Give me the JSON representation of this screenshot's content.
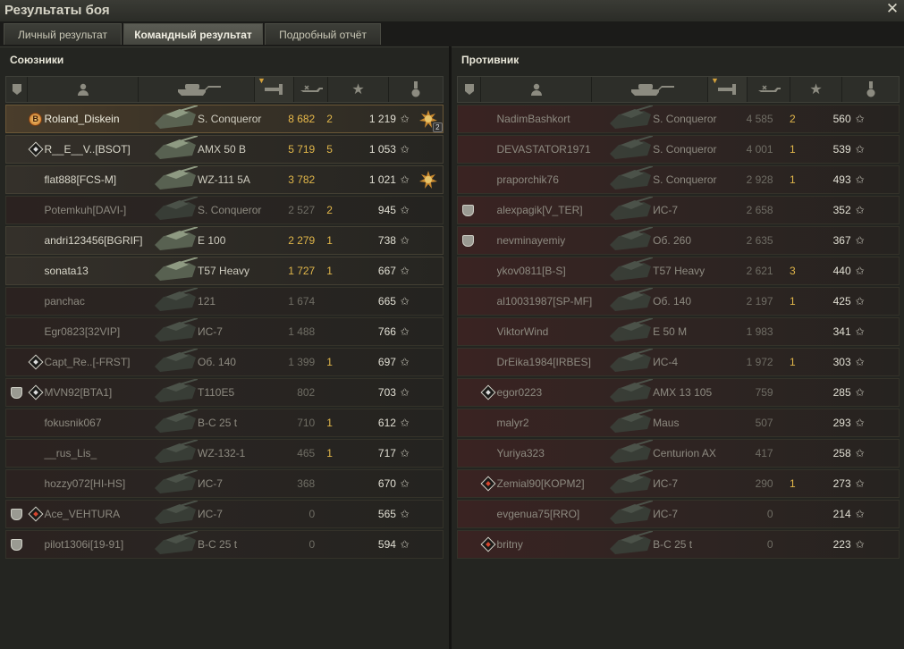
{
  "window": {
    "title": "Результаты боя"
  },
  "tabs": [
    {
      "label": "Личный результат"
    },
    {
      "label": "Командный результат"
    },
    {
      "label": "Подробный отчёт"
    }
  ],
  "active_tab": 1,
  "allies": {
    "title": "Союзники",
    "rows": [
      {
        "name": "Roland_Diskein",
        "tank": "S. Conqueror",
        "damage": "8 682",
        "kills": "2",
        "xp": "1 219",
        "state": "player",
        "left_icon": "badge",
        "medal": "medal",
        "medal_count": "2"
      },
      {
        "name": "R__E__V..[BSOT]",
        "tank": "AMX 50 B",
        "damage": "5 719",
        "kills": "5",
        "xp": "1 053",
        "state": "alive",
        "left_icon": "diamond",
        "medal": "",
        "medal_count": ""
      },
      {
        "name": "flat888[FCS-M]",
        "tank": "WZ-111 5A",
        "damage": "3 782",
        "kills": "",
        "xp": "1 021",
        "state": "alive",
        "left_icon": "",
        "medal": "medal",
        "medal_count": ""
      },
      {
        "name": "Potemkuh[DAVI-]",
        "tank": "S. Conqueror",
        "damage": "2 527",
        "kills": "2",
        "xp": "945",
        "state": "dead",
        "left_icon": "",
        "medal": "",
        "medal_count": ""
      },
      {
        "name": "andri123456[BGRIF]",
        "tank": "E 100",
        "damage": "2 279",
        "kills": "1",
        "xp": "738",
        "state": "alive",
        "left_icon": "",
        "medal": "",
        "medal_count": ""
      },
      {
        "name": "sonata13",
        "tank": "T57 Heavy",
        "damage": "1 727",
        "kills": "1",
        "xp": "667",
        "state": "alive",
        "left_icon": "",
        "medal": "",
        "medal_count": ""
      },
      {
        "name": "panchac",
        "tank": "121",
        "damage": "1 674",
        "kills": "",
        "xp": "665",
        "state": "dead",
        "left_icon": "",
        "medal": "",
        "medal_count": ""
      },
      {
        "name": "Egr0823[32VIP]",
        "tank": "ИС-7",
        "damage": "1 488",
        "kills": "",
        "xp": "766",
        "state": "dead",
        "left_icon": "",
        "medal": "",
        "medal_count": ""
      },
      {
        "name": "Capt_Re..[-FRST]",
        "tank": "Об. 140",
        "damage": "1 399",
        "kills": "1",
        "xp": "697",
        "state": "dead",
        "left_icon": "diamond",
        "medal": "",
        "medal_count": ""
      },
      {
        "name": "MVN92[BTA1]",
        "tank": "T110E5",
        "damage": "802",
        "kills": "",
        "xp": "703",
        "state": "dead",
        "left_icon": "diamond",
        "platoon": true,
        "medal": "",
        "medal_count": ""
      },
      {
        "name": "fokusnik067",
        "tank": "B-C 25 t",
        "damage": "710",
        "kills": "1",
        "xp": "612",
        "state": "dead",
        "left_icon": "",
        "medal": "",
        "medal_count": ""
      },
      {
        "name": "__rus_Lis_",
        "tank": "WZ-132-1",
        "damage": "465",
        "kills": "1",
        "xp": "717",
        "state": "dead",
        "left_icon": "",
        "medal": "",
        "medal_count": ""
      },
      {
        "name": "hozzy072[HI-HS]",
        "tank": "ИС-7",
        "damage": "368",
        "kills": "",
        "xp": "670",
        "state": "dead",
        "left_icon": "",
        "medal": "",
        "medal_count": ""
      },
      {
        "name": "Ace_VEHTURA",
        "tank": "ИС-7",
        "damage": "0",
        "kills": "",
        "xp": "565",
        "state": "dead",
        "left_icon": "diamond-red",
        "platoon": true,
        "medal": "",
        "medal_count": ""
      },
      {
        "name": "pilot1306i[19-91]",
        "tank": "B-C 25 t",
        "damage": "0",
        "kills": "",
        "xp": "594",
        "state": "dead",
        "left_icon": "",
        "platoon": true,
        "medal": "",
        "medal_count": ""
      }
    ]
  },
  "enemies": {
    "title": "Противник",
    "rows": [
      {
        "name": "NadimBashkort",
        "tank": "S. Conqueror",
        "damage": "4 585",
        "kills": "2",
        "xp": "560",
        "left_icon": "",
        "platoon": false
      },
      {
        "name": "DEVASTATOR1971",
        "tank": "S. Conqueror",
        "damage": "4 001",
        "kills": "1",
        "xp": "539",
        "left_icon": "",
        "platoon": false
      },
      {
        "name": "praporchik76",
        "tank": "S. Conqueror",
        "damage": "2 928",
        "kills": "1",
        "xp": "493",
        "left_icon": "",
        "platoon": false
      },
      {
        "name": "alexpagik[V_TER]",
        "tank": "ИС-7",
        "damage": "2 658",
        "kills": "",
        "xp": "352",
        "left_icon": "",
        "platoon": true
      },
      {
        "name": "nevminayemiy",
        "tank": "Об. 260",
        "damage": "2 635",
        "kills": "",
        "xp": "367",
        "left_icon": "",
        "platoon": true
      },
      {
        "name": "ykov0811[B-S]",
        "tank": "T57 Heavy",
        "damage": "2 621",
        "kills": "3",
        "xp": "440",
        "left_icon": "",
        "platoon": false
      },
      {
        "name": "al10031987[SP-MF]",
        "tank": "Об. 140",
        "damage": "2 197",
        "kills": "1",
        "xp": "425",
        "left_icon": "",
        "platoon": false
      },
      {
        "name": "ViktorWind",
        "tank": "E 50 M",
        "damage": "1 983",
        "kills": "",
        "xp": "341",
        "left_icon": "",
        "platoon": false
      },
      {
        "name": "DrEika1984[IRBES]",
        "tank": "ИС-4",
        "damage": "1 972",
        "kills": "1",
        "xp": "303",
        "left_icon": "",
        "platoon": false
      },
      {
        "name": "egor0223",
        "tank": "AMX 13 105",
        "damage": "759",
        "kills": "",
        "xp": "285",
        "left_icon": "diamond",
        "platoon": false
      },
      {
        "name": "malyr2",
        "tank": "Maus",
        "damage": "507",
        "kills": "",
        "xp": "293",
        "left_icon": "",
        "platoon": false
      },
      {
        "name": "Yuriya323",
        "tank": "Centurion AX",
        "damage": "417",
        "kills": "",
        "xp": "258",
        "left_icon": "",
        "platoon": false
      },
      {
        "name": "Zemial90[KOPM2]",
        "tank": "ИС-7",
        "damage": "290",
        "kills": "1",
        "xp": "273",
        "left_icon": "diamond-red",
        "platoon": false
      },
      {
        "name": "evgenua75[RRO]",
        "tank": "ИС-7",
        "damage": "0",
        "kills": "",
        "xp": "214",
        "left_icon": "",
        "platoon": false
      },
      {
        "name": "britny",
        "tank": "B-C 25 t",
        "damage": "0",
        "kills": "",
        "xp": "223",
        "left_icon": "diamond-red",
        "platoon": false
      }
    ]
  },
  "icons": {
    "close": "close-icon",
    "squad": "squad-icon",
    "player": "player-icon",
    "tank": "tank-icon",
    "damage": "damage-icon",
    "kills": "kills-icon",
    "xp": "star-icon",
    "medal": "medal-icon"
  }
}
